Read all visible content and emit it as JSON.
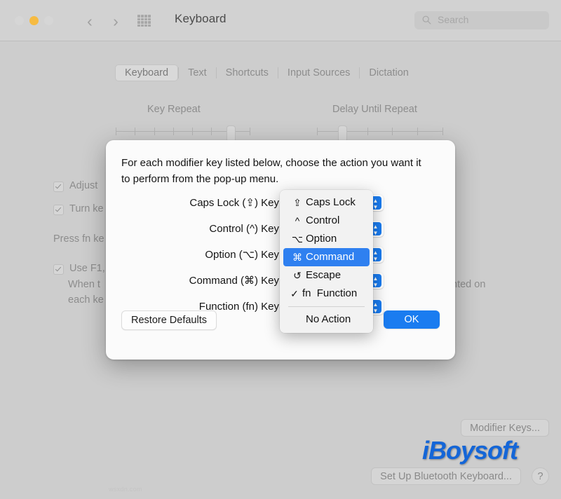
{
  "window": {
    "title": "Keyboard",
    "traffic_lights": [
      "close",
      "minimize",
      "zoom"
    ],
    "nav_back": "‹",
    "nav_forward": "›"
  },
  "search": {
    "placeholder": "Search",
    "value": ""
  },
  "tabs": [
    {
      "label": "Keyboard",
      "selected": true
    },
    {
      "label": "Text",
      "selected": false
    },
    {
      "label": "Shortcuts",
      "selected": false
    },
    {
      "label": "Input Sources",
      "selected": false
    },
    {
      "label": "Dictation",
      "selected": false
    }
  ],
  "sliders": [
    {
      "label": "Key Repeat",
      "ticks": 8,
      "thumb_index": 6
    },
    {
      "label": "Delay Until Repeat",
      "ticks": 6,
      "thumb_index": 1
    }
  ],
  "options": {
    "adjust_label": "Adjust",
    "turn_label": "Turn ke",
    "press_fn_label": "Press fn ke",
    "use_f1_label": "Use F1,",
    "when_line1": "When t",
    "when_line2": "each ke",
    "when_tail": "nted on"
  },
  "bottom_buttons": {
    "modifier_keys": "Modifier Keys...",
    "bluetooth": "Set Up Bluetooth Keyboard...",
    "help": "?"
  },
  "watermark": {
    "brand": "iBoysoft",
    "small": "wsxdn.com",
    "brand_color": "#1466d8"
  },
  "sheet": {
    "message": "For each modifier key listed below, choose the action you want it to perform from the pop-up menu.",
    "rows": [
      {
        "label": "Caps Lock (⇪) Key"
      },
      {
        "label": "Control (^) Key"
      },
      {
        "label": "Option (⌥) Key"
      },
      {
        "label": "Command (⌘) Key"
      },
      {
        "label": "Function (fn) Key"
      }
    ],
    "restore_label": "Restore Defaults",
    "ok_label": "OK"
  },
  "menu": {
    "items": [
      {
        "glyph": "⇪",
        "label": "Caps Lock",
        "selected": false,
        "checked": false
      },
      {
        "glyph": "^",
        "label": "Control",
        "selected": false,
        "checked": false
      },
      {
        "glyph": "⌥",
        "label": "Option",
        "selected": false,
        "checked": false
      },
      {
        "glyph": "⌘",
        "label": "Command",
        "selected": true,
        "checked": false
      },
      {
        "glyph": "↺",
        "label": "Escape",
        "selected": false,
        "checked": false
      },
      {
        "glyph": "fn",
        "label": "Function",
        "selected": false,
        "checked": true
      },
      {
        "separator": true
      },
      {
        "glyph": "",
        "label": "No Action",
        "selected": false,
        "checked": false
      }
    ],
    "highlight_color": "#2f80f0"
  }
}
